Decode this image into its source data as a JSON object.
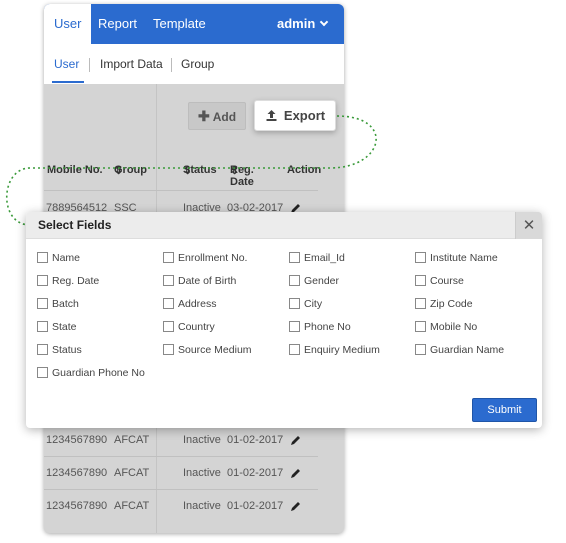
{
  "topnav": {
    "tabs": [
      {
        "label": "User",
        "active": true
      },
      {
        "label": "Report",
        "active": false
      },
      {
        "label": "Template",
        "active": false
      }
    ],
    "user_menu": "admin",
    "accent": "#2b6bcf"
  },
  "subnav": {
    "items": [
      {
        "label": "User",
        "active": true
      },
      {
        "label": "Import Data",
        "active": false
      },
      {
        "label": "Group",
        "active": false
      }
    ]
  },
  "toolbar": {
    "add_label": "Add",
    "export_label": "Export"
  },
  "table": {
    "headers": [
      "Mobile No.",
      "Group",
      "Status",
      "Reg. Date",
      "Action"
    ],
    "rows_top": [
      {
        "mobile": "7889564512",
        "group": "SSC",
        "status": "Inactive",
        "date": "03-02-2017"
      }
    ],
    "rows_bottom": [
      {
        "mobile": "1234567890",
        "group": "AFCAT",
        "status": "Inactive",
        "date": "01-02-2017"
      },
      {
        "mobile": "1234567890",
        "group": "AFCAT",
        "status": "Inactive",
        "date": "01-02-2017"
      },
      {
        "mobile": "1234567890",
        "group": "AFCAT",
        "status": "Inactive",
        "date": "01-02-2017"
      }
    ]
  },
  "modal": {
    "title": "Select Fields",
    "close_icon": "close-icon",
    "fields": [
      [
        "Name",
        "Enrollment No.",
        "Email_Id",
        "Institute Name"
      ],
      [
        "Reg. Date",
        "Date of Birth",
        "Gender",
        "Course"
      ],
      [
        "Batch",
        "Address",
        "City",
        "Zip Code"
      ],
      [
        "State",
        "Country",
        "Phone No",
        "Mobile No"
      ],
      [
        "Status",
        "Source Medium",
        "Enquiry Medium",
        "Guardian Name"
      ],
      [
        "Guardian Phone No"
      ]
    ],
    "submit_label": "Submit"
  }
}
